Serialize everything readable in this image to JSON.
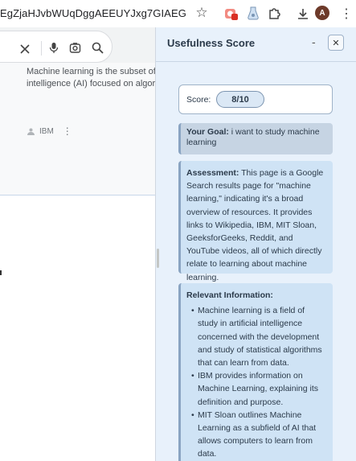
{
  "browser": {
    "url": "EgZjaHJvbWUqDggAEEUYJxg7GIAEGIoFMg4IA...",
    "profile_initial": "A",
    "icons": [
      "star-icon",
      "extension-icon",
      "extension-icon",
      "puzzle-icon",
      "download-icon",
      "kebab-icon"
    ]
  },
  "page": {
    "snippet_lines": [
      "Machine learning is the subset of ar",
      "intelligence (AI) focused on algorithr"
    ],
    "source": "IBM"
  },
  "panel": {
    "title": "Usefulness Score",
    "minimize_label": "-",
    "close_label": "✕",
    "score_label": "Score:",
    "score_value": "8/10",
    "goal_label": "Your Goal:",
    "goal_text": " i want to study machine learning",
    "assessment_label": "Assessment:",
    "assessment_text": " This page is a Google Search results page for \"machine learning,\" indicating it's a broad overview of resources. It provides links to Wikipedia, IBM, MIT Sloan, GeeksforGeeks, Reddit, and YouTube videos, all of which directly relate to learning about machine learning.",
    "relevant_title": "Relevant Information:",
    "relevant_items": [
      "Machine learning is a field of study in artificial intelligence concerned with the development and study of statistical algorithms that can learn from data.",
      "IBM provides information on Machine Learning, explaining its definition and purpose.",
      "MIT Sloan outlines Machine Learning as a subfield of AI that allows computers to learn from data."
    ]
  },
  "colors": {
    "panel_bg": "#e8f1fb",
    "box_bg": "#cfe3f5",
    "goal_bg": "#c6d4e3",
    "accent": "#8aa4c2",
    "ext_badge": "#d93025"
  }
}
